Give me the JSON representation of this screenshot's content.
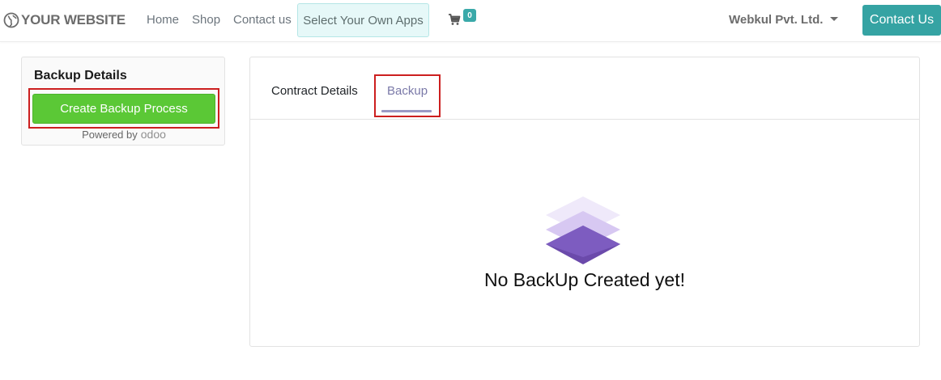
{
  "header": {
    "logo_text": "YOUR WEBSITE",
    "nav": [
      "Home",
      "Shop",
      "Contact us"
    ],
    "apps_button": "Select Your Own Apps",
    "cart_count": "0",
    "company": "Webkul Pvt. Ltd.",
    "contact_button": "Contact Us"
  },
  "left_card": {
    "title": "Backup Details",
    "create_button": "Create Backup Process",
    "powered_by": "Powered by",
    "powered_logo": "odoo"
  },
  "right_panel": {
    "tabs": [
      "Contract Details",
      "Backup"
    ],
    "active_tab": "Backup",
    "empty_message": "No BackUp Created yet!"
  },
  "colors": {
    "brand_teal": "#35a3a3",
    "create_green": "#5bc836",
    "highlight_red": "#cc1f1f",
    "active_tab": "#7a79a8"
  }
}
